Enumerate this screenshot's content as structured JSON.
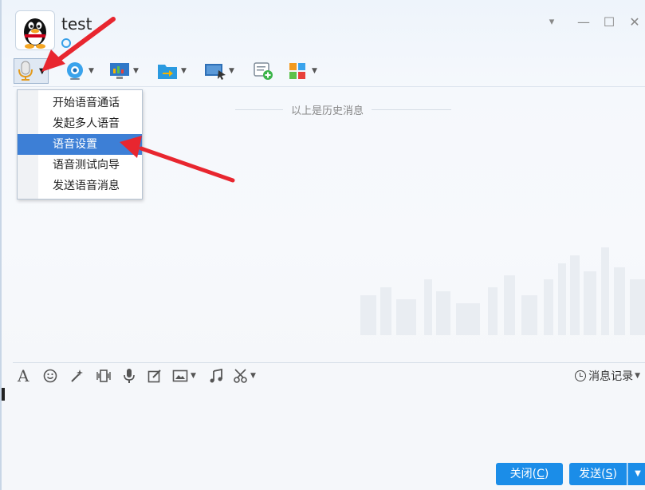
{
  "window": {
    "contact_name": "test",
    "controls": {
      "dropdown": "▾",
      "minimize": "—",
      "maximize": "☐",
      "close": "✕"
    }
  },
  "toolbar": {
    "items": [
      {
        "icon": "microphone-icon",
        "has_dropdown": true
      },
      {
        "icon": "webcam-icon",
        "has_dropdown": true
      },
      {
        "icon": "screen-share-icon",
        "has_dropdown": true
      },
      {
        "icon": "file-transfer-icon",
        "has_dropdown": true
      },
      {
        "icon": "remote-assist-icon",
        "has_dropdown": true
      },
      {
        "icon": "create-discussion-icon",
        "has_dropdown": false
      },
      {
        "icon": "apps-icon",
        "has_dropdown": true
      }
    ]
  },
  "voice_menu": {
    "items": [
      {
        "label": "开始语音通话",
        "selected": false
      },
      {
        "label": "发起多人语音",
        "selected": false
      },
      {
        "label": "语音设置",
        "selected": true
      },
      {
        "label": "语音测试向导",
        "selected": false
      },
      {
        "label": "发送语音消息",
        "selected": false
      }
    ]
  },
  "chat": {
    "history_divider": "以上是历史消息"
  },
  "input_toolbar": {
    "icons": [
      "font-icon",
      "emoji-icon",
      "magic-icon",
      "shake-icon",
      "voice-message-icon",
      "doodle-icon",
      "image-icon",
      "music-icon",
      "screenshot-icon"
    ],
    "history_label": "消息记录"
  },
  "buttons": {
    "close_label": "关闭",
    "close_hotkey": "C",
    "send_label": "发送",
    "send_hotkey": "S"
  },
  "colors": {
    "accent": "#1b8de8",
    "menu_selected": "#3d7fd6",
    "annotation_arrow": "#e8262f"
  }
}
